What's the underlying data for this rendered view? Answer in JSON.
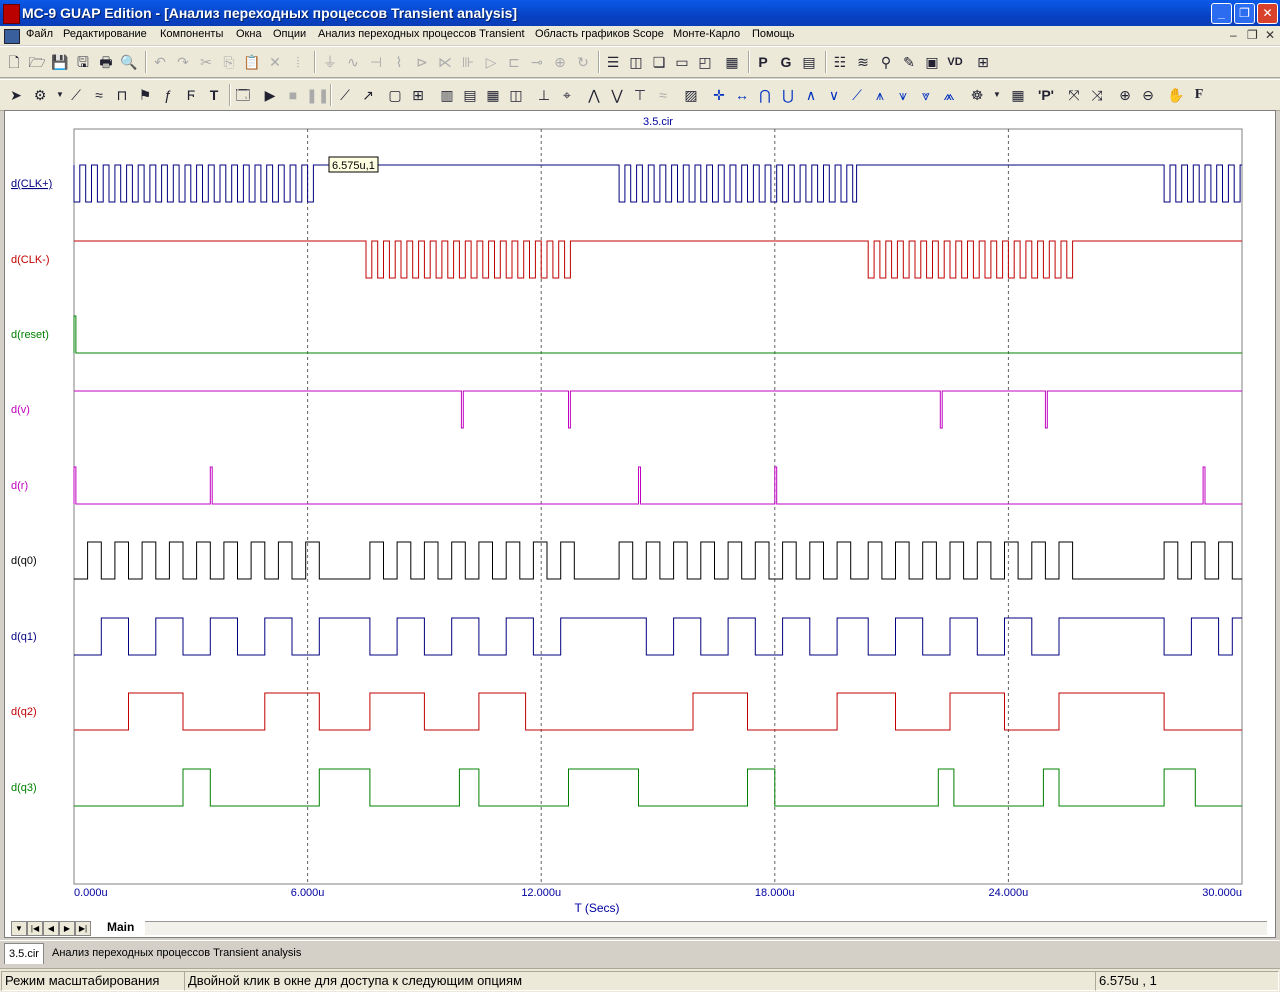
{
  "window": {
    "title": "MC-9 GUAP Edition - [Анализ переходных процессов Transient analysis]"
  },
  "menu": [
    "Файл",
    "Редактирование",
    "Компоненты",
    "Окна",
    "Опции",
    "Анализ переходных процессов Transient",
    "Область графиков Scope",
    "Монте-Карло",
    "Помощь"
  ],
  "plot": {
    "file_title": "3.5.cir",
    "x_axis_label": "T (Secs)",
    "x_ticks": [
      "0.000u",
      "6.000u",
      "12.000u",
      "18.000u",
      "24.000u",
      "30.000u"
    ],
    "cursor_tooltip": "6.575u,1",
    "cursor_x_us": 6.0
  },
  "chart_data": {
    "type": "line",
    "x_unit": "us",
    "xlim": [
      0,
      30
    ],
    "series": [
      {
        "name": "d(CLK+)",
        "color": "#000080",
        "kind": "clock",
        "bursts": [
          [
            0.0,
            6.3,
            0.3
          ],
          [
            14.0,
            20.1,
            0.3
          ],
          [
            28.0,
            30.0,
            0.3
          ]
        ]
      },
      {
        "name": "d(CLK-)",
        "color": "#c00000",
        "kind": "clock",
        "bursts": [
          [
            7.5,
            12.8,
            0.3
          ],
          [
            20.4,
            25.7,
            0.3
          ]
        ]
      },
      {
        "name": "d(reset)",
        "color": "#008000",
        "kind": "pulses",
        "base": 0,
        "pulses": [
          [
            0.0,
            0.05
          ]
        ]
      },
      {
        "name": "d(v)",
        "color": "#c000c0",
        "kind": "pulses",
        "base": 1,
        "pulses": [
          [
            9.95,
            10.0
          ],
          [
            12.7,
            12.75
          ],
          [
            22.25,
            22.3
          ],
          [
            24.95,
            25.0
          ]
        ]
      },
      {
        "name": "d(r)",
        "color": "#c000c0",
        "kind": "pulses",
        "base": 0,
        "pulses": [
          [
            0.0,
            0.05
          ],
          [
            3.5,
            3.55
          ],
          [
            14.5,
            14.55
          ],
          [
            18.0,
            18.05
          ],
          [
            29.0,
            29.05
          ]
        ]
      },
      {
        "name": "d(q0)",
        "color": "#000000",
        "kind": "steps",
        "init": 0,
        "edges": [
          0.35,
          0.7,
          1.05,
          1.4,
          1.75,
          2.1,
          2.45,
          2.8,
          3.15,
          3.5,
          3.85,
          4.2,
          4.55,
          4.9,
          5.25,
          5.6,
          5.95,
          6.3,
          7.6,
          7.95,
          8.3,
          8.65,
          9.0,
          9.35,
          9.7,
          10.05,
          10.4,
          10.75,
          11.1,
          11.45,
          11.8,
          12.15,
          12.5,
          12.85,
          14.0,
          14.35,
          14.7,
          15.05,
          15.4,
          15.75,
          16.1,
          16.45,
          16.8,
          17.15,
          17.5,
          17.85,
          18.2,
          18.55,
          18.9,
          19.25,
          19.6,
          19.95,
          20.4,
          20.75,
          21.1,
          21.45,
          21.8,
          22.15,
          22.5,
          22.85,
          23.2,
          23.55,
          23.9,
          24.25,
          24.6,
          24.95,
          25.3,
          25.65,
          28.0,
          28.35,
          28.7,
          29.05,
          29.4,
          29.75
        ]
      },
      {
        "name": "d(q1)",
        "color": "#000080",
        "kind": "steps",
        "init": 0,
        "edges": [
          0.7,
          1.4,
          2.1,
          2.8,
          3.5,
          4.2,
          4.9,
          5.6,
          6.3,
          7.6,
          8.3,
          9.0,
          9.7,
          10.4,
          11.1,
          11.8,
          12.5,
          14.7,
          15.4,
          16.1,
          16.8,
          17.5,
          18.2,
          18.9,
          19.6,
          20.4,
          21.1,
          21.8,
          22.5,
          23.2,
          23.9,
          24.6,
          25.3,
          28.0,
          28.7,
          29.4,
          29.75
        ]
      },
      {
        "name": "d(q2)",
        "color": "#c00000",
        "kind": "steps",
        "init": 0,
        "edges": [
          1.4,
          2.8,
          4.9,
          6.3,
          7.6,
          9.0,
          10.4,
          11.6,
          15.9,
          17.3,
          19.6,
          21.1,
          22.5,
          23.9,
          25.3,
          28.0
        ]
      },
      {
        "name": "d(q3)",
        "color": "#008000",
        "kind": "steps",
        "init": 0,
        "edges": [
          2.8,
          3.5,
          6.3,
          7.6,
          9.9,
          10.4,
          12.7,
          14.5,
          17.3,
          18.0,
          22.2,
          22.6,
          24.9,
          25.3,
          28.0,
          28.8
        ]
      }
    ]
  },
  "tabs": {
    "main": "Main"
  },
  "doc_tabs": [
    "3.5.cir",
    "Анализ переходных процессов Transient analysis"
  ],
  "status": {
    "mode": "Режим масштабирования",
    "hint": "Двойной клик в окне для доступа к следующим опциям",
    "coords": "6.575u , 1"
  }
}
